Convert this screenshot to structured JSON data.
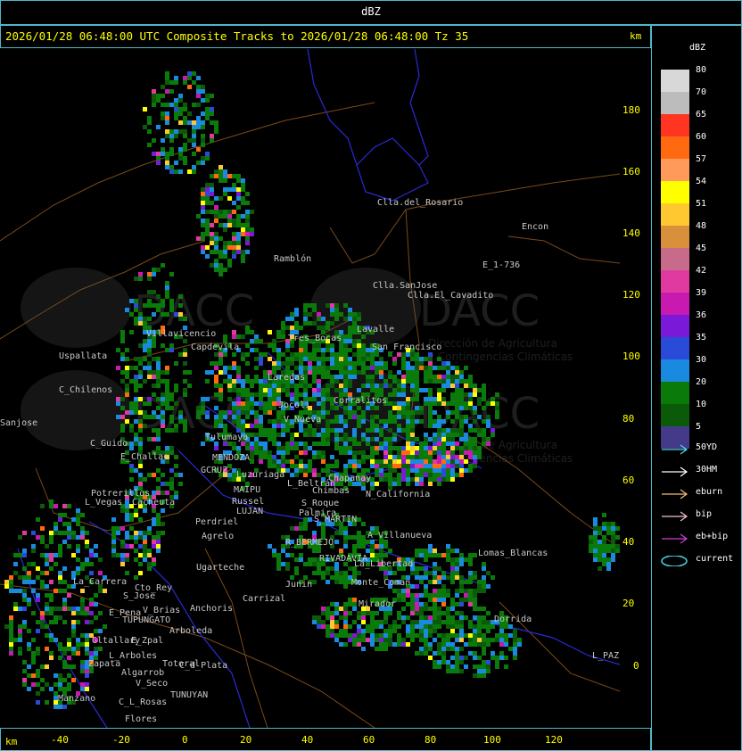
{
  "header": {
    "top_label": "dBZ",
    "title": "2026/01/28 06:48:00 UTC Composite Tracks to 2026/01/28 06:48:00 Tz 35",
    "km_top": "km",
    "km_bottom": "km"
  },
  "axes": {
    "x_ticks": [
      "-40",
      "-20",
      "0",
      "20",
      "40",
      "60",
      "80",
      "100",
      "120"
    ],
    "y_ticks": [
      "180",
      "160",
      "140",
      "120",
      "100",
      "80",
      "60",
      "40",
      "20",
      "0"
    ]
  },
  "legend": {
    "title": "dBZ",
    "scale": [
      {
        "label": "80",
        "color": "#d8d8d8"
      },
      {
        "label": "70",
        "color": "#bcbcbc"
      },
      {
        "label": "65",
        "color": "#ff3522"
      },
      {
        "label": "60",
        "color": "#ff6a11"
      },
      {
        "label": "57",
        "color": "#ff9a5a"
      },
      {
        "label": "54",
        "color": "#ffff00"
      },
      {
        "label": "51",
        "color": "#ffc830"
      },
      {
        "label": "48",
        "color": "#d8903a"
      },
      {
        "label": "45",
        "color": "#c86a8a"
      },
      {
        "label": "42",
        "color": "#e03aa0"
      },
      {
        "label": "39",
        "color": "#c81ab0"
      },
      {
        "label": "36",
        "color": "#7a1ad8"
      },
      {
        "label": "35",
        "color": "#2a4ad8"
      },
      {
        "label": "30",
        "color": "#1a8ae0"
      },
      {
        "label": "20",
        "color": "#0a7a0a"
      },
      {
        "label": "10",
        "color": "#0a5a0a"
      },
      {
        "label": "5",
        "color": "#443a8a"
      }
    ],
    "tracks": [
      {
        "label": "50YD",
        "color": "#4fd8e8",
        "kind": "arrow"
      },
      {
        "label": "30HM",
        "color": "#ffffff",
        "kind": "arrow"
      },
      {
        "label": "eburn",
        "color": "#f2c070",
        "kind": "arrow"
      },
      {
        "label": "bip",
        "color": "#f0c0d8",
        "kind": "arrow"
      },
      {
        "label": "eb+bip",
        "color": "#d040d0",
        "kind": "arrow"
      },
      {
        "label": "current",
        "color": "#4fd8e8",
        "kind": "ellipse"
      }
    ]
  },
  "watermark": {
    "logo_text": "DACC",
    "line1": "Dirección de Agricultura",
    "line2": "y Contingencias Climáticas"
  },
  "places": [
    "Clla.del_Rosario",
    "Encon",
    "E_1-736",
    "Ramblón",
    "Clla.SanJose",
    "Clla.El_Cavadito",
    "Villavicencio",
    "Capdevila",
    "Uspallata",
    "C_Chilenos",
    "Sanjose",
    "Lavalle",
    "San_Francisco",
    "Tres_Bocas",
    "Laredas",
    "C_Guido",
    "E_Challao",
    "V_Nueva",
    "Jocoli",
    "Corralitos",
    "Tulumaya",
    "MENDOZA",
    "GCRUZ",
    "Luzuriaga",
    "L_Beltrán",
    "Potrerillos",
    "Cacheuta",
    "L_Vegas",
    "MAIPU",
    "Russel",
    "LUJAN",
    "Perdriel",
    "Chapanay",
    "Chimbas",
    "S_Roque",
    "Palmira",
    "N_California",
    "S_MARTIN",
    "Agrelo",
    "A_Villanueva",
    "R_BERMEJO",
    "RIVADAVIA",
    "Ugarteche",
    "La_Libertad",
    "Lomas_Blancas",
    "La_Carrera",
    "Cto_Rey",
    "S_Jose",
    "Carrizal",
    "Junin",
    "Monte_Coman",
    "Mirador",
    "Anchoris",
    "E_Pena",
    "TUPUNGATO",
    "V_Brias",
    "Arboleda",
    "Gltallary",
    "E_Zpal",
    "L_Arboles",
    "C_d_Plata",
    "Zapata",
    "Algarrob",
    "Totoral",
    "V_Seco",
    "Manzano",
    "C_L_Rosas",
    "TUNUYAN",
    "Flores",
    "Dorrida",
    "L_PAZ"
  ]
}
